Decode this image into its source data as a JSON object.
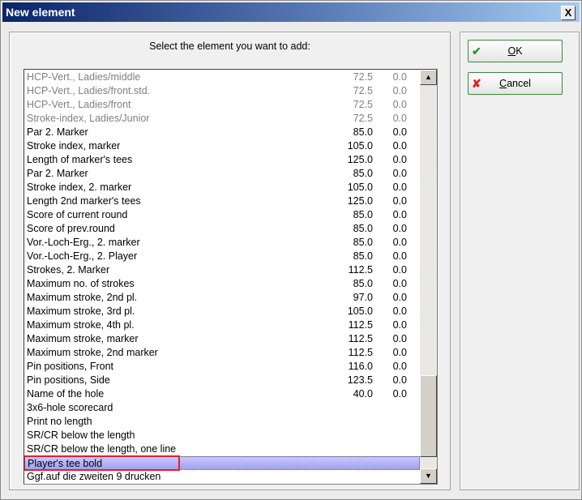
{
  "window": {
    "title": "New element",
    "close": "X"
  },
  "prompt": "Select the element you want to add:",
  "buttons": {
    "ok": {
      "mn": "O",
      "rest": "K"
    },
    "cancel": {
      "mn": "C",
      "rest": "ancel"
    }
  },
  "colors": {
    "ok_icon": "#2a9a2a",
    "cancel_icon": "#e02020",
    "highlight": "#e02030"
  },
  "scroll": {
    "position_percent": 92
  },
  "rows": [
    {
      "label": "HCP-Vert., Ladies/middle",
      "v1": "72.5",
      "v2": "0.0",
      "gray": true
    },
    {
      "label": "HCP-Vert., Ladies/front.std.",
      "v1": "72.5",
      "v2": "0.0",
      "gray": true
    },
    {
      "label": "HCP-Vert., Ladies/front",
      "v1": "72.5",
      "v2": "0.0",
      "gray": true
    },
    {
      "label": "Stroke-index, Ladies/Junior",
      "v1": "72.5",
      "v2": "0.0",
      "gray": true
    },
    {
      "label": "Par 2. Marker",
      "v1": "85.0",
      "v2": "0.0"
    },
    {
      "label": "Stroke index, marker",
      "v1": "105.0",
      "v2": "0.0"
    },
    {
      "label": "Length of marker's tees",
      "v1": "125.0",
      "v2": "0.0"
    },
    {
      "label": "Par 2. Marker",
      "v1": "85.0",
      "v2": "0.0"
    },
    {
      "label": "Stroke index, 2. marker",
      "v1": "105.0",
      "v2": "0.0"
    },
    {
      "label": "Length 2nd marker's tees",
      "v1": "125.0",
      "v2": "0.0"
    },
    {
      "label": "Score of current round",
      "v1": "85.0",
      "v2": "0.0"
    },
    {
      "label": "Score of prev.round",
      "v1": "85.0",
      "v2": "0.0"
    },
    {
      "label": "Vor.-Loch-Erg., 2. marker",
      "v1": "85.0",
      "v2": "0.0"
    },
    {
      "label": "Vor.-Loch-Erg., 2. Player",
      "v1": "85.0",
      "v2": "0.0"
    },
    {
      "label": "Strokes, 2. Marker",
      "v1": "112.5",
      "v2": "0.0"
    },
    {
      "label": "Maximum no. of strokes",
      "v1": "85.0",
      "v2": "0.0"
    },
    {
      "label": "Maximum stroke, 2nd pl.",
      "v1": "97.0",
      "v2": "0.0"
    },
    {
      "label": "Maximum stroke, 3rd pl.",
      "v1": "105.0",
      "v2": "0.0"
    },
    {
      "label": "Maximum stroke, 4th pl.",
      "v1": "112.5",
      "v2": "0.0"
    },
    {
      "label": "Maximum stroke, marker",
      "v1": "112.5",
      "v2": "0.0"
    },
    {
      "label": "Maximum stroke, 2nd marker",
      "v1": "112.5",
      "v2": "0.0"
    },
    {
      "label": "Pin positions, Front",
      "v1": "116.0",
      "v2": "0.0"
    },
    {
      "label": "Pin positions, Side",
      "v1": "123.5",
      "v2": "0.0"
    },
    {
      "label": "Name of the hole",
      "v1": "40.0",
      "v2": "0.0"
    },
    {
      "label": "3x6-hole scorecard",
      "v1": "",
      "v2": ""
    },
    {
      "label": "Print no length",
      "v1": "",
      "v2": ""
    },
    {
      "label": "SR/CR below the length",
      "v1": "",
      "v2": ""
    },
    {
      "label": "SR/CR below the length, one line",
      "v1": "",
      "v2": ""
    },
    {
      "label": "Player's tee bold",
      "v1": "",
      "v2": "",
      "selected": true
    },
    {
      "label": "Ggf.auf die zweiten 9 drucken",
      "v1": "",
      "v2": ""
    }
  ]
}
